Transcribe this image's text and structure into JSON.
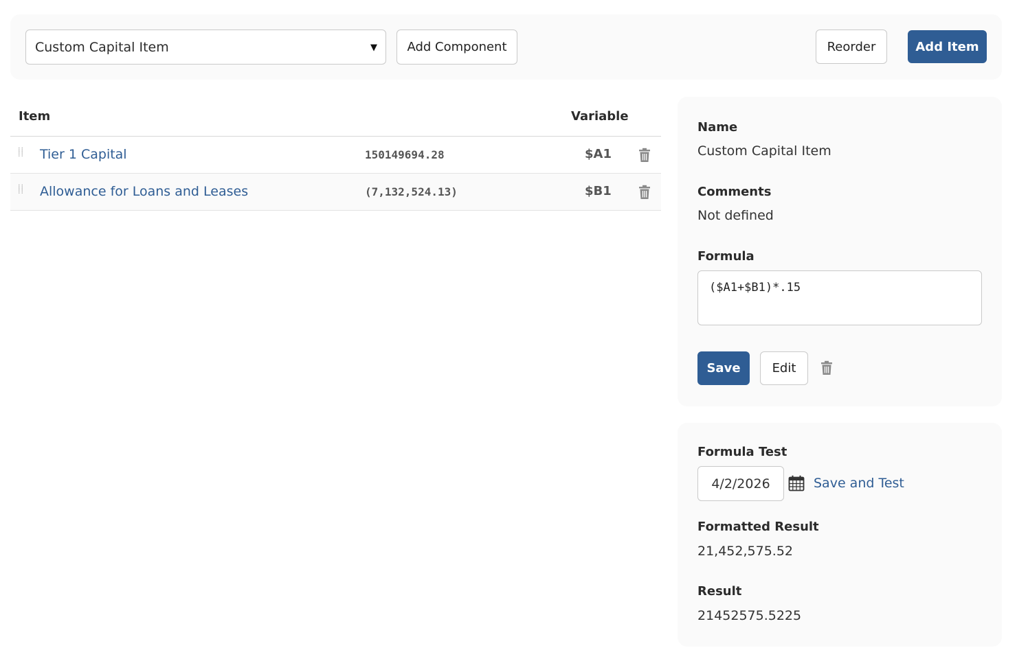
{
  "toolbar": {
    "selected_item": "Custom Capital Item",
    "add_component_label": "Add Component",
    "reorder_label": "Reorder",
    "add_item_label": "Add Item"
  },
  "table": {
    "headers": {
      "item": "Item",
      "variable": "Variable"
    },
    "rows": [
      {
        "name": "Tier 1 Capital",
        "value": "150149694.28",
        "variable": "$A1"
      },
      {
        "name": "Allowance for Loans and Leases",
        "value": "(7,132,524.13)",
        "variable": "$B1"
      }
    ]
  },
  "details": {
    "name_label": "Name",
    "name_value": "Custom Capital Item",
    "comments_label": "Comments",
    "comments_value": "Not defined",
    "formula_label": "Formula",
    "formula_value": "($A1+$B1)*.15",
    "save_label": "Save",
    "edit_label": "Edit"
  },
  "test": {
    "title": "Formula Test",
    "date_value": "4/2/2026",
    "save_and_test_label": "Save and Test",
    "formatted_result_label": "Formatted Result",
    "formatted_result_value": "21,452,575.52",
    "result_label": "Result",
    "result_value": "21452575.5225"
  },
  "colors": {
    "primary": "#2f5d94",
    "panel_bg": "#fafafa",
    "border": "#c9c9c9"
  },
  "icons": {
    "row_delete": "trash-icon",
    "drag": "drag-handle-icon",
    "date": "calendar-icon",
    "dropdown": "caret-down-icon"
  }
}
